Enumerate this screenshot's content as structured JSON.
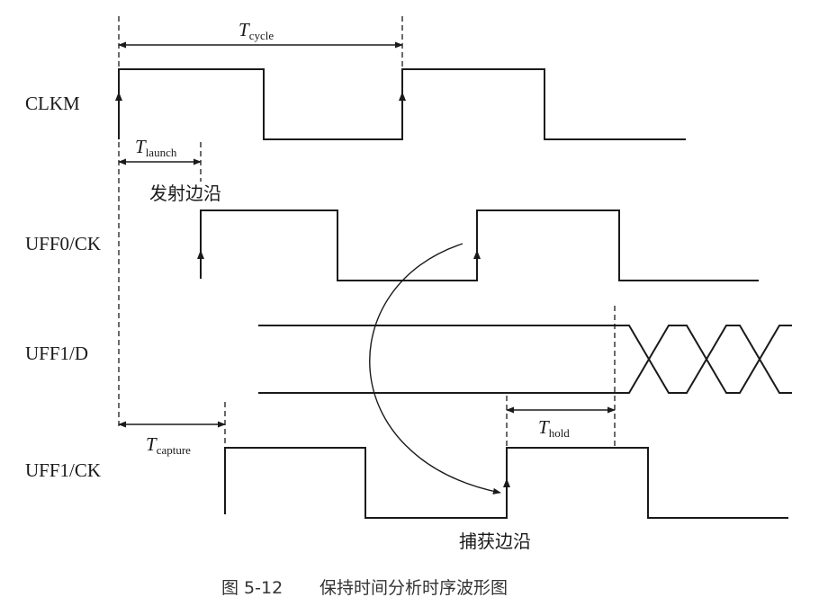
{
  "signals": {
    "clkm": "CLKM",
    "uff0_ck": "UFF0/CK",
    "uff1_d": "UFF1/D",
    "uff1_ck": "UFF1/CK"
  },
  "timings": {
    "cycle": {
      "main": "T",
      "sub": "cycle"
    },
    "launch": {
      "main": "T",
      "sub": "launch"
    },
    "capture": {
      "main": "T",
      "sub": "capture"
    },
    "hold": {
      "main": "T",
      "sub": "hold"
    }
  },
  "annotations": {
    "launch_edge": "发射边沿",
    "capture_edge": "捕获边沿"
  },
  "caption": {
    "number": "图 5-12",
    "title": "保持时间分析时序波形图"
  }
}
